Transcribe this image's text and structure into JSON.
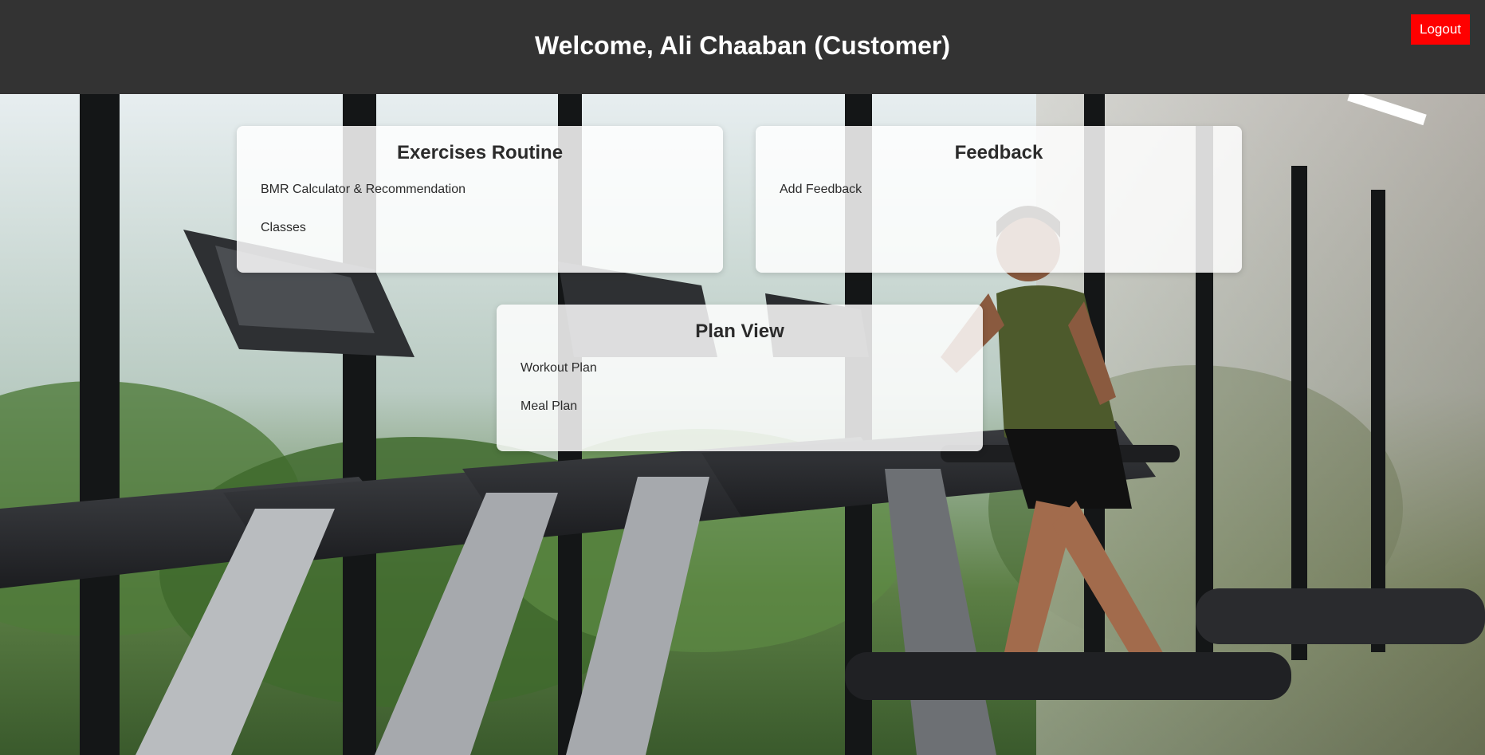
{
  "header": {
    "title": "Welcome, Ali Chaaban (Customer)",
    "logout_label": "Logout",
    "background_color": "#333333",
    "logout_color": "#ff0000"
  },
  "background": {
    "description_icon": "gym-treadmill-background-image"
  },
  "cards": {
    "exercises": {
      "title": "Exercises Routine",
      "links": [
        "BMR Calculator & Recommendation",
        "Classes"
      ]
    },
    "feedback": {
      "title": "Feedback",
      "links": [
        "Add Feedback"
      ]
    },
    "plan": {
      "title": "Plan View",
      "links": [
        "Workout Plan",
        "Meal Plan"
      ]
    }
  }
}
